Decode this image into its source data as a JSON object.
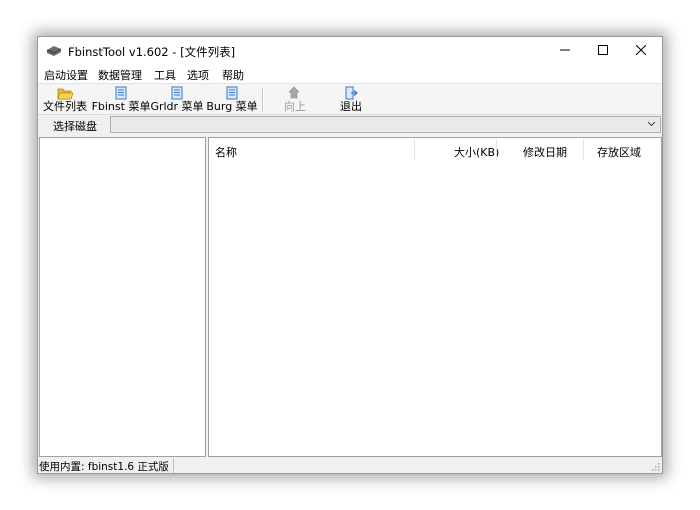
{
  "window": {
    "title": "FbinstTool v1.602 - [文件列表]",
    "app_icon": "drive-icon"
  },
  "menu": {
    "items": [
      {
        "label": "启动设置"
      },
      {
        "label": "数据管理"
      },
      {
        "label": "工具"
      },
      {
        "label": "选项"
      },
      {
        "label": "帮助"
      }
    ]
  },
  "toolbar": {
    "buttons": [
      {
        "label": "文件列表",
        "icon": "folder-icon",
        "enabled": true
      },
      {
        "label": "Fbinst 菜单",
        "icon": "document-icon",
        "enabled": true
      },
      {
        "label": "Grldr 菜单",
        "icon": "document-icon",
        "enabled": true
      },
      {
        "label": "Burg 菜单",
        "icon": "document-icon",
        "enabled": true
      },
      {
        "label": "向上",
        "icon": "up-arrow-icon",
        "enabled": false
      },
      {
        "label": "退出",
        "icon": "exit-icon",
        "enabled": true
      }
    ]
  },
  "disk": {
    "label": "选择磁盘",
    "selected": ""
  },
  "file_list": {
    "columns": [
      {
        "label": "名称"
      },
      {
        "label": "大小(KB)"
      },
      {
        "label": "修改日期"
      },
      {
        "label": "存放区域"
      }
    ],
    "rows": []
  },
  "status": {
    "text": "使用内置: fbinst1.6 正式版"
  },
  "colors": {
    "window_bg": "#f0f0f0",
    "panel_bg": "#ffffff",
    "folder": "#e8b830",
    "doc": "#3a78c8"
  }
}
